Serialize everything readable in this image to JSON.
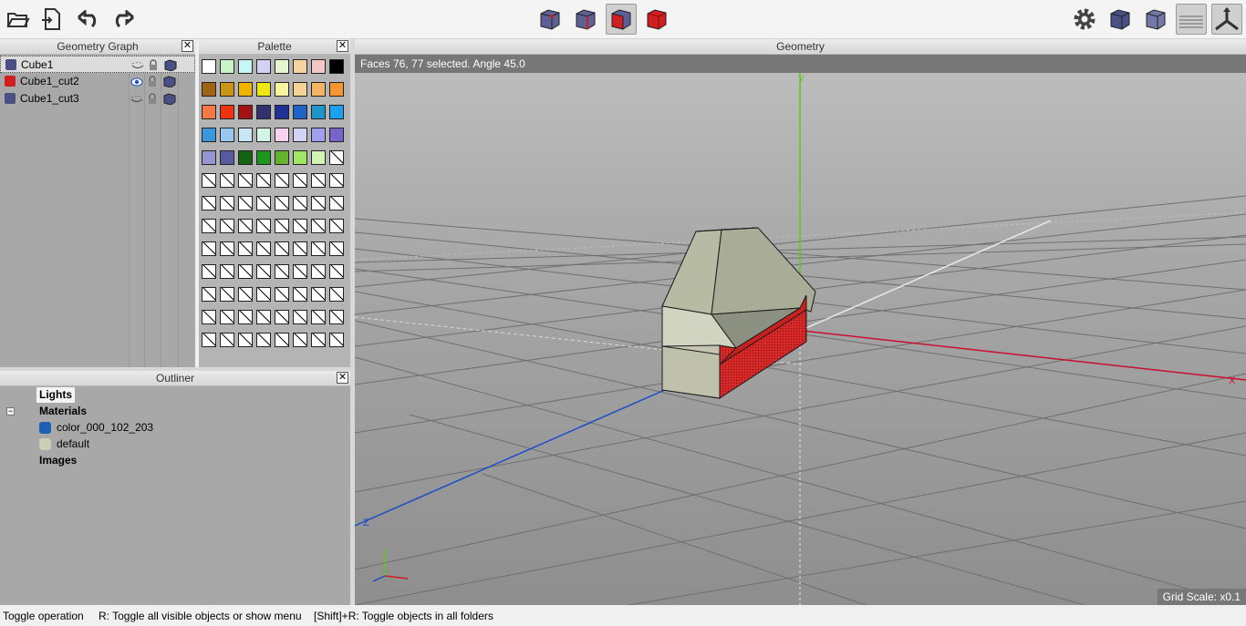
{
  "toolbar": {
    "left_icons": [
      "open-folder-icon",
      "import-icon",
      "undo-icon",
      "redo-icon"
    ],
    "center_icons": [
      "select-vertices-icon",
      "select-edges-icon",
      "select-faces-icon",
      "select-objects-icon"
    ],
    "right_icons": [
      "settings-gear-icon",
      "shaded-cube-icon",
      "wireframe-cube-icon",
      "ground-plane-icon",
      "axes-icon"
    ]
  },
  "geometry_graph": {
    "title": "Geometry Graph",
    "close": "✕",
    "rows": [
      {
        "label": "Cube1",
        "color": "#4a4f86",
        "selected": true,
        "eye": "hidden"
      },
      {
        "label": "Cube1_cut2",
        "color": "#d21e1e",
        "selected": false,
        "eye": "visible"
      },
      {
        "label": "Cube1_cut3",
        "color": "#4a4f86",
        "selected": false,
        "eye": "hidden"
      }
    ]
  },
  "palette": {
    "title": "Palette",
    "close": "✕",
    "colors": [
      [
        "#ffffff",
        "#c8f5c8",
        "#c8f5f5",
        "#d2d2f5",
        "#e6f5d2",
        "#f5d2a0",
        "#f5c8c8",
        "#000000"
      ],
      [
        "#a06414",
        "#c89614",
        "#f0b400",
        "#f0e614",
        "#f5f5a0",
        "#f5d296",
        "#f5b464",
        "#f59632"
      ],
      [
        "#f57846",
        "#f03214",
        "#a01414",
        "#32326e",
        "#1e3296",
        "#1e64c8",
        "#1e96c8",
        "#1ea0f0"
      ],
      [
        "#3c96dc",
        "#96c8f0",
        "#c8e6f5",
        "#d2f5e6",
        "#f5d2f0",
        "#d2d2f5",
        "#a0a0f0",
        "#7864c8"
      ],
      [
        "#9696d2",
        "#5a5aa0",
        "#146414",
        "#1e961e",
        "#64b432",
        "#a0e664",
        "#d2f5b4",
        "empty"
      ]
    ],
    "empty_rows": 8
  },
  "outliner": {
    "title": "Outliner",
    "close": "✕",
    "lights": "Lights",
    "materials": "Materials",
    "collapse": "−",
    "material_items": [
      {
        "label": "color_000_102_203",
        "color": "#1e5fb4"
      },
      {
        "label": "default",
        "color": "#c8cfb4"
      }
    ],
    "images": "Images"
  },
  "viewport": {
    "title": "Geometry",
    "info": "Faces 76, 77 selected. Angle 45.0",
    "grid_scale": "Grid Scale: x0.1",
    "axis_x": "X",
    "axis_y": "Y",
    "axis_z": "Z"
  },
  "status": {
    "left": "Toggle operation",
    "middle": "R: Toggle all visible objects or show menu",
    "right": "[Shift]+R: Toggle objects in all folders"
  }
}
